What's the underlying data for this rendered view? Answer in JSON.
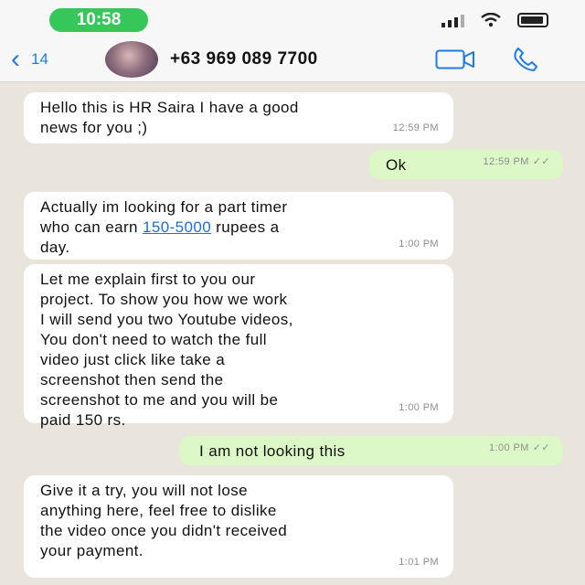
{
  "status_bar": {
    "time": "10:58"
  },
  "header": {
    "back_count": "14",
    "contact": "+63 969 089 7700"
  },
  "messages": [
    {
      "dir": "in",
      "text": "Hello this is HR Saira I have a good\nnews for you ;)",
      "time": "12:59 PM"
    },
    {
      "dir": "out",
      "text": "Ok",
      "time": "12:59 PM"
    },
    {
      "dir": "in",
      "text_before": "Actually im looking for a part timer\nwho can earn ",
      "link": "150-5000",
      "text_after": " rupees a\nday.",
      "time": "1:00 PM"
    },
    {
      "dir": "in",
      "text": "Let me explain first to you our\nproject. To show you how we work\nI will send you two Youtube videos,\nYou don't need to watch the full\nvideo just click like take a\nscreenshot then send the\nscreenshot to me and you will be\npaid 150 rs.",
      "time": "1:00 PM"
    },
    {
      "dir": "out",
      "text": "I am not looking this",
      "time": "1:00 PM"
    },
    {
      "dir": "in",
      "text": "Give it a try, you will not lose\nanything here, feel free to dislike\nthe video once you didn't received\nyour payment.",
      "time": "1:01 PM"
    }
  ]
}
